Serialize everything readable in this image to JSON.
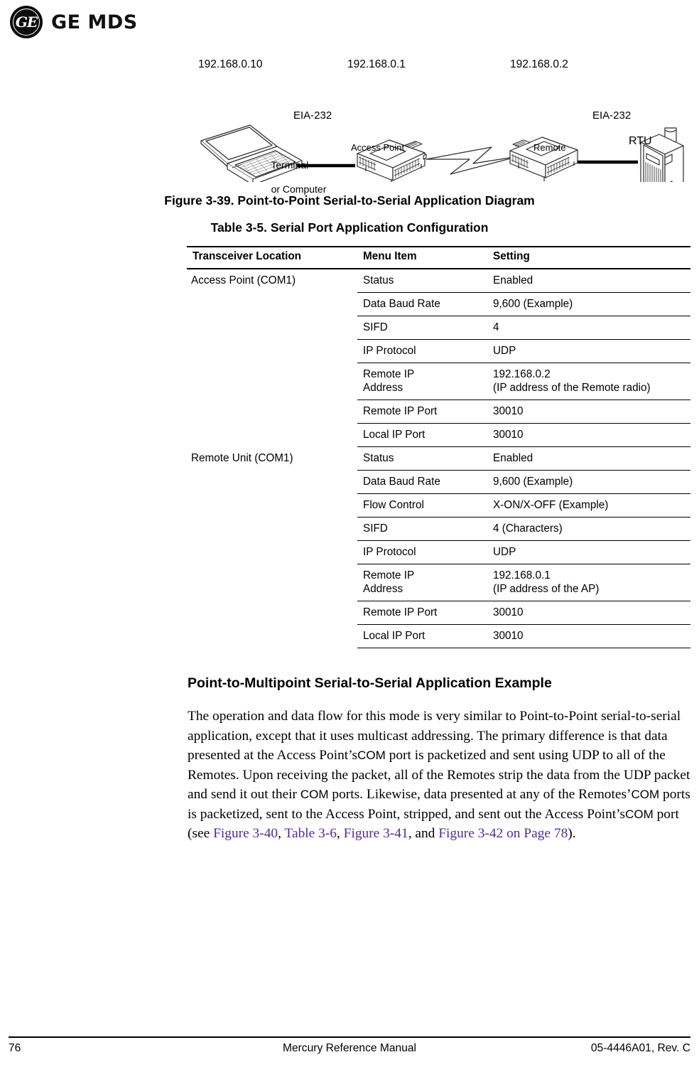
{
  "brand": {
    "monogram_letters": "GE",
    "wordmark": "GE MDS"
  },
  "diagram": {
    "ip_terminal": "192.168.0.10",
    "ip_access_point": "192.168.0.1",
    "ip_remote": "192.168.0.2",
    "label_terminal_line1": "Terminal",
    "label_terminal_line2": "or Computer",
    "label_access_point": "Access Point",
    "label_remote": "Remote",
    "label_rtu": "RTU",
    "label_eia_left": "EIA-232",
    "label_eia_right": "EIA-232"
  },
  "figure_caption": "Figure 3-39. Point-to-Point Serial-to-Serial Application Diagram",
  "table_caption": "Table 3-5. Serial Port Application Configuration",
  "table": {
    "headers": [
      "Transceiver Location",
      "Menu Item",
      "Setting"
    ],
    "groups": [
      {
        "location": "Access Point (COM1)",
        "rows": [
          {
            "menu": "Status",
            "setting": "Enabled"
          },
          {
            "menu": "Data Baud Rate",
            "setting": "9,600 (Example)"
          },
          {
            "menu": "SIFD",
            "setting": "4"
          },
          {
            "menu": "IP Protocol",
            "setting": "UDP"
          },
          {
            "menu": "Remote IP",
            "menu_line2": "Address",
            "setting": "192.168.0.2",
            "setting_line2": "(IP address of the Remote radio)"
          },
          {
            "menu": "Remote IP Port",
            "setting": "30010"
          },
          {
            "menu": "Local IP Port",
            "setting": "30010"
          }
        ]
      },
      {
        "location": "Remote Unit (COM1)",
        "rows": [
          {
            "menu": "Status",
            "setting": "Enabled"
          },
          {
            "menu": "Data Baud Rate",
            "setting": "9,600 (Example)"
          },
          {
            "menu": "Flow Control",
            "setting": "X-ON/X-OFF (Example)"
          },
          {
            "menu": "SIFD",
            "setting": "4 (Characters)"
          },
          {
            "menu": "IP Protocol",
            "setting": "UDP"
          },
          {
            "menu": "Remote IP",
            "menu_line2": "Address",
            "setting": "192.168.0.1",
            "setting_line2": "(IP address of the AP)"
          },
          {
            "menu": "Remote IP Port",
            "setting": "30010"
          },
          {
            "menu": "Local IP Port",
            "setting": "30010"
          }
        ]
      }
    ]
  },
  "section": {
    "heading": "Point-to-Multipoint Serial-to-Serial Application Example",
    "paragraph_parts": {
      "p1": "The operation and data flow for this mode is very similar to Point-to-Point serial-to-serial application, except that it uses multicast addressing. The primary difference is that data presented at the Access Point",
      "com1": "’s",
      "com_a": "COM",
      "p2": " port is packetized and sent using UDP to all of the Remotes. Upon receiving the packet, all of the Remotes strip the data from the UDP packet and send it out their ",
      "com_b": "COM",
      "p3": " ports. Likewise, data presented at any of the Remotes",
      "apos2": "’",
      "com_c": "COM",
      "p4": " ports is packetized, sent to the Access Point, stripped, and sent out the Access Point",
      "apos3": "’s",
      "com_d": "COM",
      "p5": " port (see ",
      "xref1": "Figure 3-40",
      "sep1": ", ",
      "xref2": "Table 3-6",
      "sep2": ", ",
      "xref3": "Figure 3-41",
      "sep3": ", and ",
      "xref4": "Figure 3-42 on Page 78",
      "end": ")."
    }
  },
  "footer": {
    "page_number": "76",
    "document_title": "Mercury Reference Manual",
    "document_id": "05-4446A01, Rev. C"
  },
  "colors": {
    "text": "#000000",
    "xref": "#5b2a8c",
    "rule": "#000000"
  }
}
